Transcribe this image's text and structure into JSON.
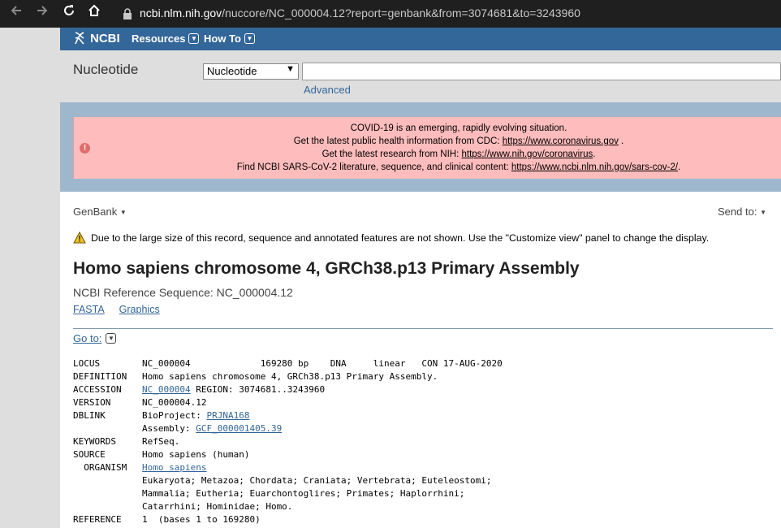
{
  "browser": {
    "url_host": "ncbi.nlm.nih.gov",
    "url_path": "/nuccore/NC_000004.12?report=genbank&from=3074681&to=3243960"
  },
  "header": {
    "logo": "NCBI",
    "menu": [
      "Resources",
      "How To"
    ]
  },
  "search": {
    "db_title": "Nucleotide",
    "db_selected": "Nucleotide",
    "query": "",
    "advanced_label": "Advanced"
  },
  "covid": {
    "line1": "COVID-19 is an emerging, rapidly evolving situation.",
    "line2_text": "Get the latest public health information from CDC: ",
    "line2_link": "https://www.coronavirus.gov",
    "line2_end": " .",
    "line3_text": "Get the latest research from NIH: ",
    "line3_link": "https://www.nih.gov/coronavirus",
    "line3_end": ".",
    "line4_text": "Find NCBI SARS-CoV-2 literature, sequence, and clinical content: ",
    "line4_link": "https://www.ncbi.nlm.nih.gov/sars-cov-2/",
    "line4_end": "."
  },
  "record": {
    "format_label": "GenBank",
    "send_to_label": "Send to:",
    "warning": "Due to the large size of this record, sequence and annotated features are not shown. Use the \"Customize view\" panel to change the display.",
    "title": "Homo sapiens chromosome 4, GRCh38.p13 Primary Assembly",
    "refseq_line": "NCBI Reference Sequence: NC_000004.12",
    "views": [
      "FASTA",
      "Graphics"
    ],
    "goto_label": "Go to:"
  },
  "genbank": {
    "locus_key": "LOCUS",
    "locus_val": "NC_000004             169280 bp    DNA     linear   CON 17-AUG-2020",
    "definition_key": "DEFINITION",
    "definition_val": "Homo sapiens chromosome 4, GRCh38.p13 Primary Assembly.",
    "accession_key": "ACCESSION",
    "accession_link": "NC_000004",
    "accession_rest": " REGION: 3074681..3243960",
    "version_key": "VERSION",
    "version_val": "NC_000004.12",
    "dblink_key": "DBLINK",
    "bioproject_label": "BioProject: ",
    "bioproject_link": "PRJNA168",
    "assembly_label": "Assembly: ",
    "assembly_link": "GCF_000001405.39",
    "keywords_key": "KEYWORDS",
    "keywords_val": "RefSeq.",
    "source_key": "SOURCE",
    "source_val": "Homo sapiens (human)",
    "organism_key": "  ORGANISM",
    "organism_link": "Homo sapiens",
    "lineage": [
      "Eukaryota; Metazoa; Chordata; Craniata; Vertebrata; Euteleostomi;",
      "Mammalia; Eutheria; Euarchontoglires; Primates; Haplorrhini;",
      "Catarrhini; Hominidae; Homo."
    ],
    "reference_key": "REFERENCE",
    "reference_val": "1  (bases 1 to 169280)"
  },
  "colors": {
    "ncbi_blue": "#336699",
    "covid_bg": "#ffbcbc",
    "band_bg": "#9fb7cc"
  }
}
